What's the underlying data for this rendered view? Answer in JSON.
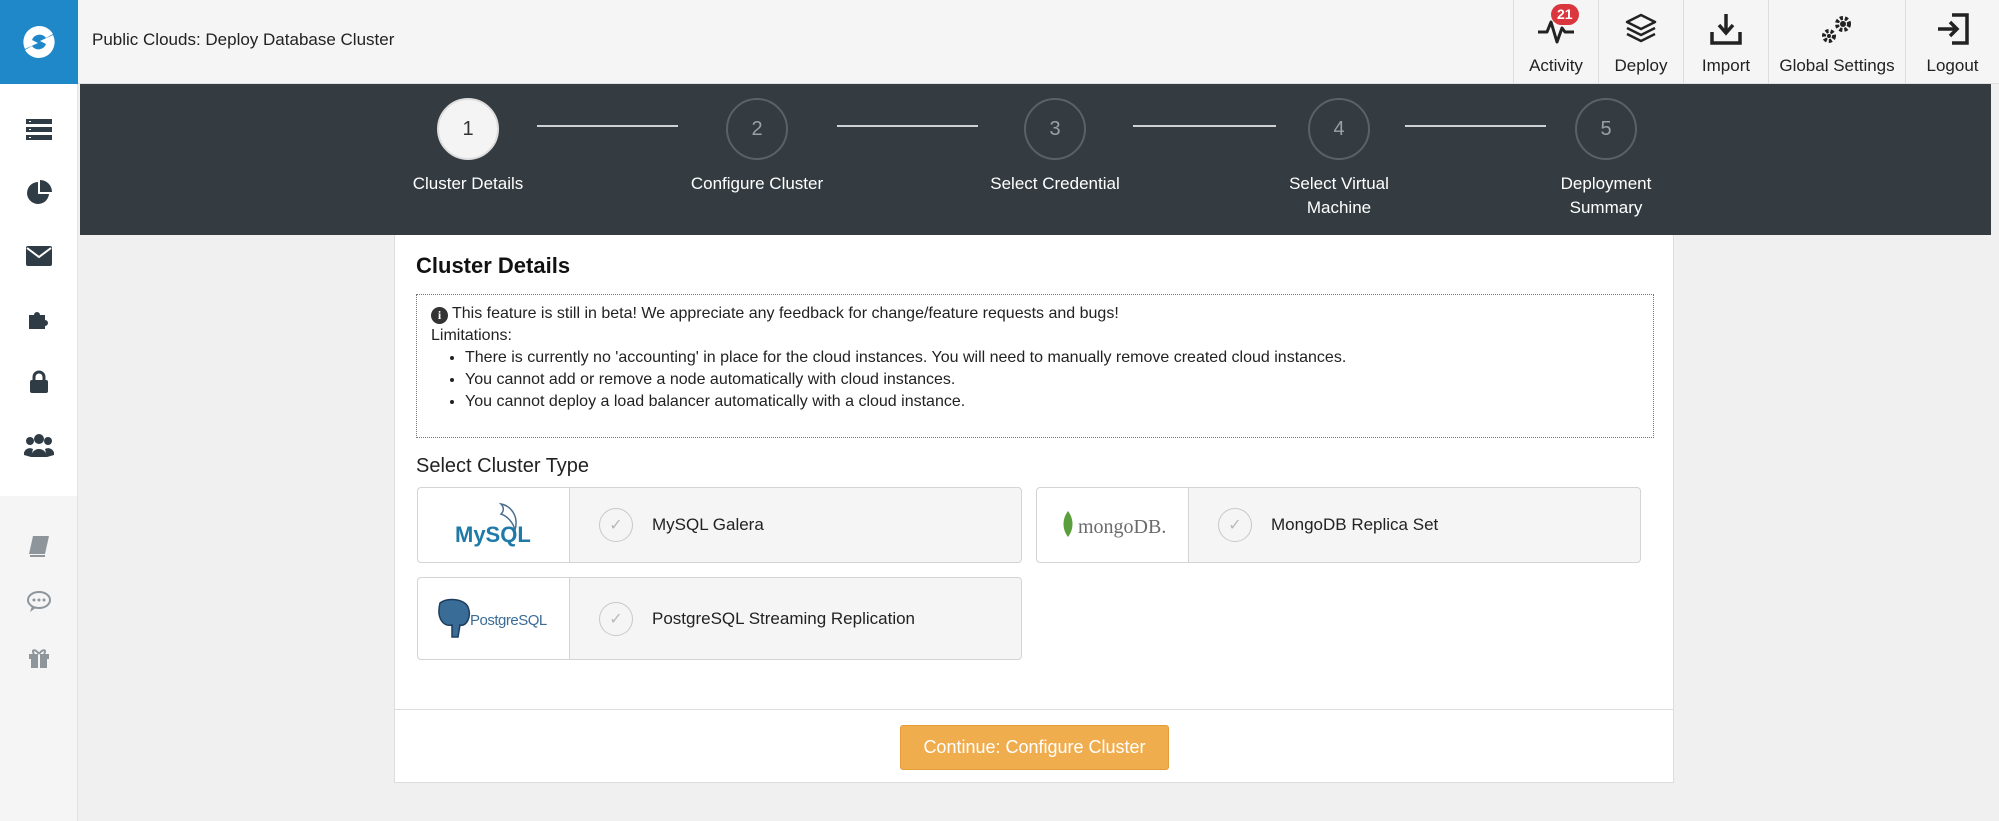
{
  "header": {
    "title": "Public Clouds: Deploy Database Cluster",
    "actions": [
      {
        "label": "Activity",
        "icon": "activity-icon",
        "badge": "21"
      },
      {
        "label": "Deploy",
        "icon": "layers-icon"
      },
      {
        "label": "Import",
        "icon": "import-icon"
      },
      {
        "label": "Global Settings",
        "icon": "gears-icon"
      },
      {
        "label": "Logout",
        "icon": "logout-icon"
      }
    ]
  },
  "sidebar": {
    "top_items": [
      "clusters-icon",
      "pie-chart-icon",
      "envelope-icon",
      "puzzle-icon",
      "lock-icon",
      "users-icon"
    ],
    "bottom_items": [
      "book-icon",
      "comment-icon",
      "gift-icon"
    ]
  },
  "stepper": {
    "steps": [
      {
        "number": "1",
        "label": "Cluster Details",
        "active": true
      },
      {
        "number": "2",
        "label": "Configure Cluster",
        "active": false
      },
      {
        "number": "3",
        "label": "Select Credential",
        "active": false
      },
      {
        "number": "4",
        "label": "Select Virtual Machine",
        "active": false
      },
      {
        "number": "5",
        "label": "Deployment Summary",
        "active": false
      }
    ]
  },
  "panel": {
    "title": "Cluster Details",
    "notice": {
      "headline": "This feature is still in beta! We appreciate any feedback for change/feature requests and bugs!",
      "limitations_label": "Limitations:",
      "items": [
        "There is currently no 'accounting' in place for the cloud instances. You will need to manually remove created cloud instances.",
        "You cannot add or remove a node automatically with cloud instances.",
        "You cannot deploy a load balancer automatically with a cloud instance."
      ]
    },
    "select_title": "Select Cluster Type",
    "cluster_types": [
      {
        "name": "MySQL Galera",
        "logo_text": "MySQL"
      },
      {
        "name": "MongoDB Replica Set",
        "logo_text": "mongoDB."
      },
      {
        "name": "PostgreSQL Streaming Replication",
        "logo_text": "PostgreSQL"
      }
    ],
    "continue_label": "Continue: Configure Cluster"
  },
  "colors": {
    "brand": "#1e88c8",
    "stepper_bg": "#343c42",
    "continue": "#f0ad4e",
    "badge": "#d9363e"
  }
}
